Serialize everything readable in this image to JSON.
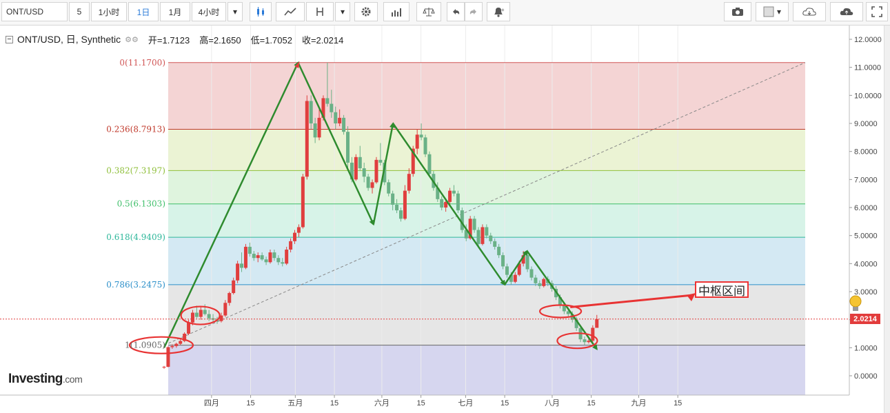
{
  "toolbar": {
    "symbol": "ONT/USD",
    "interval_input": "5",
    "intervals": [
      "1小时",
      "1日",
      "1月",
      "4小时"
    ],
    "active_interval": "1日",
    "dropdown_glyph": "▾",
    "icons": [
      "candles-icon",
      "line-chart-icon",
      "indicator-icon",
      "gear-icon",
      "bar-chart-icon",
      "balance-icon",
      "undo-icon",
      "redo-icon",
      "alert-icon",
      "camera-icon",
      "color-box-icon",
      "cloud-download-icon",
      "cloud-upload-icon",
      "fullscreen-icon"
    ]
  },
  "legend": {
    "title": "ONT/USD, 日, Synthetic",
    "open": "开=1.7123",
    "high": "高=2.1650",
    "low": "低=1.7052",
    "close": "收=2.0214"
  },
  "logo": {
    "brand": "Investing",
    "suffix": ".com"
  },
  "current_price_label": "2.0214",
  "annotation_label": "中枢区间",
  "colors": {
    "up": "#e03e3e",
    "down": "#6ab187",
    "arrow": "#2e8b2e",
    "circle": "#e83333"
  },
  "chart_data": {
    "type": "candlestick",
    "title": "ONT/USD, 日, Synthetic",
    "y_range": [
      -0.7,
      12.3
    ],
    "y_ticks": [
      "12.0000",
      "11.0000",
      "10.0000",
      "9.0000",
      "8.0000",
      "7.0000",
      "6.0000",
      "5.0000",
      "4.0000",
      "3.0000",
      "2.0000",
      "1.0000",
      "0.0000"
    ],
    "y_tick_values": [
      12,
      11,
      10,
      9,
      8,
      7,
      6,
      5,
      4,
      3,
      2,
      1,
      0
    ],
    "x_labels": [
      {
        "label": "四月",
        "t": 17
      },
      {
        "label": "15",
        "t": 31
      },
      {
        "label": "五月",
        "t": 47
      },
      {
        "label": "15",
        "t": 61
      },
      {
        "label": "六月",
        "t": 78
      },
      {
        "label": "15",
        "t": 92
      },
      {
        "label": "七月",
        "t": 108
      },
      {
        "label": "15",
        "t": 122
      },
      {
        "label": "八月",
        "t": 139
      },
      {
        "label": "15",
        "t": 153
      },
      {
        "label": "九月",
        "t": 170
      },
      {
        "label": "15",
        "t": 184
      }
    ],
    "fib_levels": [
      {
        "label": "0(11.1700)",
        "value": 11.17,
        "color": "#d05555",
        "fill": "#f4d4d4"
      },
      {
        "label": "0.236(8.7913)",
        "value": 8.7913,
        "color": "#c0392b",
        "fill": "#ebf3d4"
      },
      {
        "label": "0.382(7.3197)",
        "value": 7.3197,
        "color": "#8fbf3a",
        "fill": "#dff4de"
      },
      {
        "label": "0.5(6.1303)",
        "value": 6.1303,
        "color": "#3fbf6a",
        "fill": "#d7f3e8"
      },
      {
        "label": "0.618(4.9409)",
        "value": 4.9409,
        "color": "#2db79a",
        "fill": "#d4e9f3"
      },
      {
        "label": "0.786(3.2475)",
        "value": 3.2475,
        "color": "#2b8fc9",
        "fill": "#e6e6e6"
      },
      {
        "label": "1(1.0905)",
        "value": 1.0905,
        "color": "#666666",
        "fill": "#d6d6ef"
      }
    ],
    "current_price": 2.0214,
    "wave_points": [
      {
        "t": 0,
        "v": 1.0
      },
      {
        "t": 48,
        "v": 11.17
      },
      {
        "t": 75,
        "v": 5.4
      },
      {
        "t": 82,
        "v": 9.0
      },
      {
        "t": 122,
        "v": 3.25
      },
      {
        "t": 130,
        "v": 4.45
      },
      {
        "t": 155,
        "v": 0.95
      }
    ],
    "ohlc": [
      [
        0.3,
        0.35,
        0.25,
        0.32
      ],
      [
        0.32,
        1.05,
        0.3,
        1.02
      ],
      [
        1.02,
        1.12,
        0.96,
        1.06
      ],
      [
        1.06,
        1.18,
        1.0,
        1.14
      ],
      [
        1.14,
        1.3,
        1.1,
        1.24
      ],
      [
        1.24,
        1.55,
        1.2,
        1.5
      ],
      [
        1.5,
        2.0,
        1.45,
        1.9
      ],
      [
        1.9,
        2.35,
        1.8,
        2.25
      ],
      [
        2.25,
        2.5,
        2.05,
        2.1
      ],
      [
        2.1,
        2.45,
        2.0,
        2.35
      ],
      [
        2.35,
        2.55,
        2.15,
        2.2
      ],
      [
        2.2,
        2.35,
        1.95,
        2.05
      ],
      [
        2.05,
        2.2,
        1.9,
        2.0
      ],
      [
        2.0,
        2.1,
        1.85,
        1.95
      ],
      [
        1.95,
        2.25,
        1.9,
        2.15
      ],
      [
        2.15,
        2.7,
        2.1,
        2.6
      ],
      [
        2.6,
        3.0,
        2.5,
        2.95
      ],
      [
        2.95,
        3.5,
        2.9,
        3.4
      ],
      [
        3.4,
        4.1,
        3.3,
        4.0
      ],
      [
        4.0,
        4.4,
        3.7,
        3.85
      ],
      [
        3.85,
        4.7,
        3.8,
        4.6
      ],
      [
        4.6,
        4.75,
        4.25,
        4.35
      ],
      [
        4.35,
        4.45,
        4.1,
        4.2
      ],
      [
        4.2,
        4.4,
        4.05,
        4.3
      ],
      [
        4.3,
        4.4,
        4.1,
        4.15
      ],
      [
        4.15,
        4.25,
        3.95,
        4.05
      ],
      [
        4.05,
        4.5,
        4.0,
        4.4
      ],
      [
        4.4,
        4.5,
        4.1,
        4.2
      ],
      [
        4.2,
        4.3,
        3.95,
        4.05
      ],
      [
        4.05,
        4.2,
        3.9,
        4.0
      ],
      [
        4.0,
        4.6,
        3.95,
        4.5
      ],
      [
        4.5,
        4.9,
        4.4,
        4.8
      ],
      [
        4.8,
        5.2,
        4.7,
        5.1
      ],
      [
        5.1,
        5.4,
        4.95,
        5.3
      ],
      [
        5.3,
        7.2,
        5.25,
        7.1
      ],
      [
        7.1,
        10.0,
        7.0,
        9.8
      ],
      [
        9.8,
        10.0,
        8.8,
        9.0
      ],
      [
        9.0,
        9.2,
        8.3,
        8.5
      ],
      [
        8.5,
        9.5,
        8.4,
        9.2
      ],
      [
        9.2,
        10.0,
        9.1,
        9.9
      ],
      [
        9.9,
        11.17,
        9.6,
        9.7
      ],
      [
        9.7,
        10.2,
        9.2,
        9.4
      ],
      [
        9.4,
        9.6,
        8.8,
        9.0
      ],
      [
        9.0,
        9.5,
        8.9,
        9.2
      ],
      [
        9.2,
        9.3,
        8.6,
        8.7
      ],
      [
        8.7,
        8.9,
        7.4,
        7.6
      ],
      [
        7.6,
        7.8,
        6.9,
        7.0
      ],
      [
        7.0,
        7.9,
        6.95,
        7.8
      ],
      [
        7.8,
        8.2,
        7.3,
        7.4
      ],
      [
        7.4,
        7.6,
        6.9,
        7.1
      ],
      [
        7.1,
        7.2,
        6.6,
        6.7
      ],
      [
        6.7,
        7.0,
        6.5,
        6.9
      ],
      [
        6.9,
        7.8,
        6.85,
        7.7
      ],
      [
        7.7,
        8.3,
        7.5,
        7.6
      ],
      [
        7.6,
        7.7,
        6.8,
        6.9
      ],
      [
        6.9,
        7.0,
        6.4,
        6.5
      ],
      [
        6.5,
        6.6,
        5.9,
        6.1
      ],
      [
        6.1,
        6.3,
        5.8,
        5.9
      ],
      [
        5.9,
        6.0,
        5.5,
        5.6
      ],
      [
        5.6,
        6.8,
        5.55,
        6.6
      ],
      [
        6.6,
        7.4,
        6.5,
        7.2
      ],
      [
        7.2,
        8.2,
        7.1,
        8.1
      ],
      [
        8.1,
        8.8,
        7.9,
        8.6
      ],
      [
        8.6,
        9.0,
        8.4,
        8.5
      ],
      [
        8.5,
        8.6,
        7.8,
        7.9
      ],
      [
        7.9,
        8.0,
        7.1,
        7.2
      ],
      [
        7.2,
        7.3,
        6.6,
        6.7
      ],
      [
        6.7,
        6.9,
        6.2,
        6.3
      ],
      [
        6.3,
        6.4,
        5.9,
        6.0
      ],
      [
        6.0,
        6.3,
        5.85,
        6.2
      ],
      [
        6.2,
        6.7,
        6.1,
        6.6
      ],
      [
        6.6,
        6.8,
        6.4,
        6.5
      ],
      [
        6.5,
        6.6,
        5.8,
        5.9
      ],
      [
        5.9,
        6.0,
        5.1,
        5.2
      ],
      [
        5.2,
        5.4,
        4.8,
        4.9
      ],
      [
        4.9,
        5.7,
        4.85,
        5.6
      ],
      [
        5.6,
        5.7,
        5.1,
        5.2
      ],
      [
        5.2,
        5.3,
        4.6,
        4.7
      ],
      [
        4.7,
        5.4,
        4.65,
        5.3
      ],
      [
        5.3,
        5.4,
        4.9,
        5.0
      ],
      [
        5.0,
        5.1,
        4.7,
        4.8
      ],
      [
        4.8,
        4.9,
        4.5,
        4.6
      ],
      [
        4.6,
        4.7,
        4.2,
        4.3
      ],
      [
        4.3,
        4.4,
        3.8,
        3.9
      ],
      [
        3.9,
        4.0,
        3.5,
        3.6
      ],
      [
        3.6,
        3.7,
        3.25,
        3.35
      ],
      [
        3.35,
        3.7,
        3.3,
        3.6
      ],
      [
        3.6,
        4.1,
        3.55,
        4.0
      ],
      [
        4.0,
        4.45,
        3.9,
        4.3
      ],
      [
        4.3,
        4.4,
        3.7,
        3.8
      ],
      [
        3.8,
        3.9,
        3.4,
        3.5
      ],
      [
        3.5,
        3.6,
        3.2,
        3.3
      ],
      [
        3.3,
        3.4,
        3.1,
        3.2
      ],
      [
        3.2,
        3.5,
        3.15,
        3.45
      ],
      [
        3.45,
        3.55,
        3.2,
        3.3
      ],
      [
        3.3,
        3.4,
        3.0,
        3.1
      ],
      [
        3.1,
        3.2,
        2.7,
        2.8
      ],
      [
        2.8,
        2.9,
        2.4,
        2.5
      ],
      [
        2.5,
        2.6,
        2.2,
        2.3
      ],
      [
        2.3,
        2.4,
        2.1,
        2.2
      ],
      [
        2.2,
        2.3,
        1.9,
        2.0
      ],
      [
        2.0,
        2.1,
        1.6,
        1.7
      ],
      [
        1.7,
        1.8,
        1.2,
        1.3
      ],
      [
        1.3,
        1.4,
        1.1,
        1.2
      ],
      [
        1.2,
        1.35,
        1.15,
        1.25
      ],
      [
        1.25,
        1.8,
        1.2,
        1.71
      ],
      [
        1.71,
        2.17,
        1.71,
        2.02
      ]
    ]
  }
}
